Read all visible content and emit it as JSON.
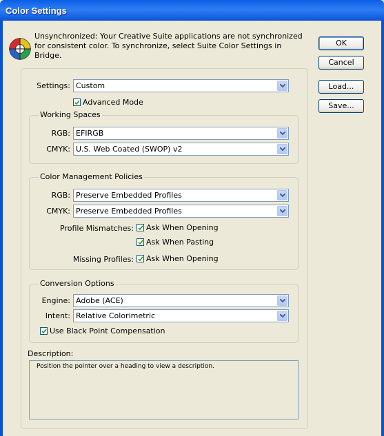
{
  "window": {
    "title": "Color Settings"
  },
  "sync_message": "Unsynchronized: Your Creative Suite applications are not synchronized for consistent color. To synchronize, select Suite Color Settings in Bridge.",
  "buttons": {
    "ok": "OK",
    "cancel": "Cancel",
    "load": "Load...",
    "save": "Save..."
  },
  "settings": {
    "label": "Settings:",
    "value": "Custom",
    "advanced_mode": "Advanced Mode"
  },
  "working_spaces": {
    "legend": "Working Spaces",
    "rgb_label": "RGB:",
    "rgb_value": "EFIRGB",
    "cmyk_label": "CMYK:",
    "cmyk_value": "U.S. Web Coated (SWOP) v2"
  },
  "policies": {
    "legend": "Color Management Policies",
    "rgb_label": "RGB:",
    "rgb_value": "Preserve Embedded Profiles",
    "cmyk_label": "CMYK:",
    "cmyk_value": "Preserve Embedded Profiles",
    "mismatch_label": "Profile Mismatches:",
    "ask_opening": "Ask When Opening",
    "ask_pasting": "Ask When Pasting",
    "missing_label": "Missing Profiles:",
    "missing_ask_opening": "Ask When Opening"
  },
  "conversion": {
    "legend": "Conversion Options",
    "engine_label": "Engine:",
    "engine_value": "Adobe (ACE)",
    "intent_label": "Intent:",
    "intent_value": "Relative Colorimetric",
    "bpc": "Use Black Point Compensation"
  },
  "description": {
    "label": "Description:",
    "text": "Position the pointer over a heading to view a description."
  }
}
